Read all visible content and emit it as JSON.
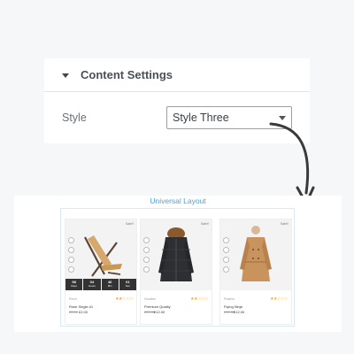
{
  "settings_panel": {
    "title": "Content Settings",
    "style_label": "Style",
    "style_value": "Style Three"
  },
  "preview": {
    "title": "Universal Layout",
    "products": [
      {
        "badge": "Sale!!",
        "category": "Pinch",
        "name": "Rose Single #1",
        "price_old": "£3.00",
        "price_new": "£2.00",
        "rating": "★★☆☆☆",
        "countdown": [
          {
            "num": "98",
            "unit": "Days"
          },
          {
            "num": "04",
            "unit": "Hours"
          },
          {
            "num": "46",
            "unit": "Min"
          },
          {
            "num": "01",
            "unit": "Sec"
          }
        ]
      },
      {
        "badge": "Sale!!",
        "category": "Hoodies",
        "name": "Premium Quality",
        "price_old": "£20.00",
        "price_new": "£12.00",
        "rating": "★★☆☆☆"
      },
      {
        "badge": "Sale!!",
        "category": "Posters",
        "name": "Flying Ninja",
        "price_old": "£15.00",
        "price_new": "£12.00",
        "rating": "★★☆☆☆"
      }
    ]
  },
  "colors": {
    "accent": "#4aa3d8",
    "star": "#f2a93b",
    "countdown_bg": "#333333"
  },
  "icons": [
    "caret-down-icon",
    "select-caret-icon",
    "curved-arrow-icon",
    "search-icon",
    "heart-icon",
    "compare-icon",
    "cart-icon"
  ]
}
